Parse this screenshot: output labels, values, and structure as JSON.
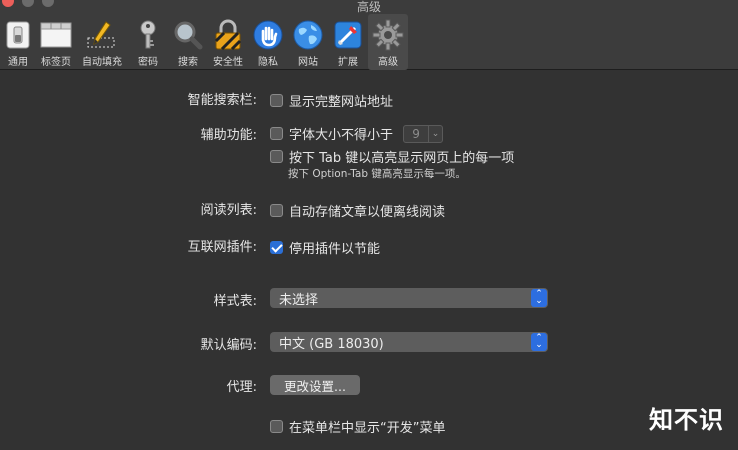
{
  "window": {
    "title": "高级"
  },
  "toolbar": {
    "items": [
      {
        "label": "通用",
        "icon": "general-switch-icon"
      },
      {
        "label": "标签页",
        "icon": "tabs-icon"
      },
      {
        "label": "自动填充",
        "icon": "autofill-pencil-icon"
      },
      {
        "label": "密码",
        "icon": "key-icon"
      },
      {
        "label": "搜索",
        "icon": "magnifier-icon"
      },
      {
        "label": "安全性",
        "icon": "lock-icon"
      },
      {
        "label": "隐私",
        "icon": "hand-icon"
      },
      {
        "label": "网站",
        "icon": "globe-icon"
      },
      {
        "label": "扩展",
        "icon": "puzzle-icon"
      },
      {
        "label": "高级",
        "icon": "gear-icon",
        "selected": true
      }
    ]
  },
  "settings": {
    "smart_search": {
      "label": "智能搜索栏:",
      "option": "显示完整网站地址",
      "checked": false
    },
    "accessibility": {
      "label": "辅助功能:",
      "min_font_option": "字体大小不得小于",
      "min_font_value": "9",
      "tab_option": "按下 Tab 键以高亮显示网页上的每一项",
      "tab_note": "按下 Option-Tab 键高亮显示每一项。"
    },
    "reading_list": {
      "label": "阅读列表:",
      "option": "自动存储文章以便离线阅读",
      "checked": false
    },
    "plugins": {
      "label": "互联网插件:",
      "option": "停用插件以节能",
      "checked": true
    },
    "stylesheet": {
      "label": "样式表:",
      "value": "未选择"
    },
    "encoding": {
      "label": "默认编码:",
      "value": "中文 (GB 18030)"
    },
    "proxy": {
      "label": "代理:",
      "button": "更改设置..."
    },
    "develop": {
      "option": "在菜单栏中显示“开发”菜单",
      "checked": false
    }
  },
  "watermark": "知不识",
  "colors": {
    "accent": "#2b6fd6",
    "background": "#323232"
  }
}
